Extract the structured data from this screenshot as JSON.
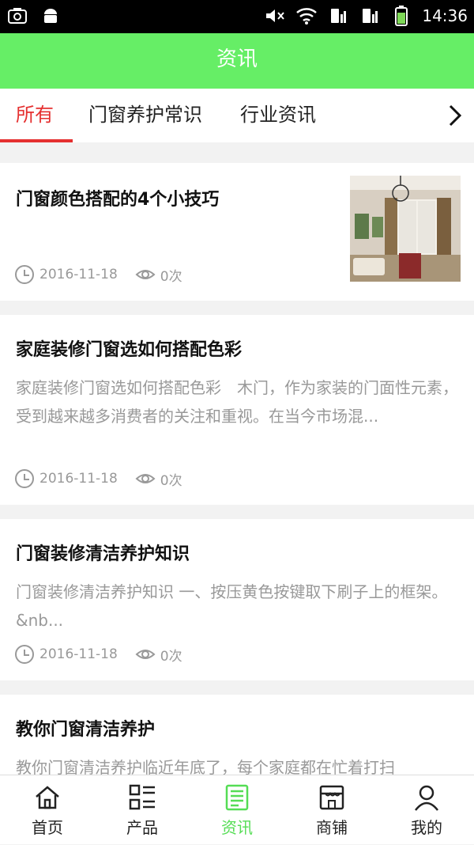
{
  "status_bar": {
    "time": "14:36"
  },
  "header": {
    "title": "资讯"
  },
  "tabs": [
    {
      "label": "所有",
      "active": true
    },
    {
      "label": "门窗养护常识",
      "active": false
    },
    {
      "label": "行业资讯",
      "active": false
    }
  ],
  "articles": [
    {
      "title": "门窗颜色搭配的4个小技巧",
      "summary": "",
      "date": "2016-11-18",
      "views": "0次",
      "has_image": true
    },
    {
      "title": "家庭装修门窗选如何搭配色彩",
      "summary": "家庭装修门窗选如何搭配色彩　木门，作为家装的门面性元素，受到越来越多消费者的关注和重视。在当今市场混...",
      "date": "2016-11-18",
      "views": "0次"
    },
    {
      "title": "门窗装修清洁养护知识",
      "summary": "门窗装修清洁养护知识 一、按压黄色按键取下刷子上的框架。　&nb...",
      "date": "2016-11-18",
      "views": "0次"
    },
    {
      "title": "教你门窗清洁养护",
      "summary": "教你门窗清洁养护临近年底了，每个家庭都在忙着打扫",
      "date": "",
      "views": ""
    }
  ],
  "bottom_nav": [
    {
      "label": "首页",
      "icon": "home-icon"
    },
    {
      "label": "产品",
      "icon": "product-list-icon"
    },
    {
      "label": "资讯",
      "icon": "news-icon",
      "active": true
    },
    {
      "label": "商铺",
      "icon": "shop-icon"
    },
    {
      "label": "我的",
      "icon": "user-icon"
    }
  ],
  "colors": {
    "header_bg": "#66ee66",
    "active_tab": "#e53030",
    "active_nav": "#55dd55",
    "muted_text": "#999999"
  }
}
